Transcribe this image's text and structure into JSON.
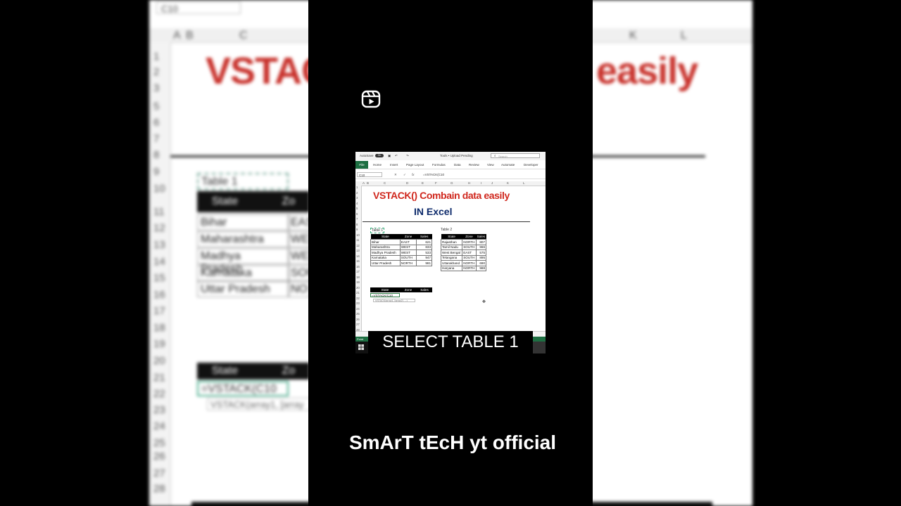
{
  "background": {
    "name_box": "C10",
    "columns": [
      "A",
      "B",
      "C",
      "K",
      "L"
    ],
    "rows": [
      "1",
      "2",
      "3",
      "5",
      "6",
      "7",
      "8",
      "9",
      "10",
      "11",
      "12",
      "13",
      "14",
      "15",
      "16",
      "17",
      "18",
      "19",
      "20",
      "21",
      "22",
      "23",
      "24",
      "25",
      "26",
      "27",
      "28"
    ],
    "title_left": "VSTACK",
    "title_right": "easily",
    "table_caption": "Table 1",
    "table_header": "State",
    "table_header_cut": "Zo",
    "states": [
      "Bihar",
      "Maharashtra",
      "Madhya Pradesh",
      "Karnataka",
      "Uttar Pradesh"
    ],
    "zones_cut": [
      "EAS",
      "WE",
      "WE",
      "SOU",
      "NO"
    ],
    "formula": "=VSTACK(C10",
    "tooltip": "VSTACK(array1, [array"
  },
  "excel": {
    "titlebar": {
      "autosave_label": "AutoSave",
      "toggle": "On",
      "file_name": "Tools • Upload Pending",
      "search_placeholder": "Search"
    },
    "ribbon_tabs": [
      "File",
      "Home",
      "Insert",
      "Page Layout",
      "Formulas",
      "Data",
      "Review",
      "View",
      "Automate",
      "Developer"
    ],
    "name_box": "C10",
    "formula": "=VSTACK(C10",
    "columns": [
      "A",
      "B",
      "C",
      "D",
      "E",
      "F",
      "G",
      "H",
      "I",
      "J",
      "K",
      "L"
    ],
    "rows": [
      "1",
      "2",
      "3",
      "4",
      "5",
      "6",
      "7",
      "8",
      "9",
      "10",
      "11",
      "12",
      "13",
      "14",
      "15",
      "16",
      "17",
      "18",
      "19",
      "20",
      "21",
      "22",
      "23",
      "24",
      "25",
      "26",
      "27",
      "28"
    ],
    "title_line1": "VSTACK() Combain data easily",
    "title_line2": "IN Excel",
    "table1": {
      "caption": "Table 1",
      "headers": [
        "State",
        "Zone",
        "Sales"
      ],
      "rows": [
        [
          "Bihar",
          "EAST",
          "621"
        ],
        [
          "Maharashtra",
          "WEST",
          "833"
        ],
        [
          "Madhya Pradesh",
          "WEST",
          "533"
        ],
        [
          "Karnataka",
          "SOUTH",
          "947"
        ],
        [
          "Uttar Pradesh",
          "NORTH",
          "981"
        ]
      ]
    },
    "table2": {
      "caption": "Table 2",
      "headers": [
        "State",
        "Zone",
        "Sales"
      ],
      "rows": [
        [
          "Rajasthan",
          "NORTH",
          "807"
        ],
        [
          "Tamil Nadu",
          "SOUTH",
          "966"
        ],
        [
          "West Bengal",
          "EAST",
          "575"
        ],
        [
          "Telangana",
          "SOUTH",
          "895"
        ],
        [
          "Uttarakhand",
          "NORTH",
          "690"
        ],
        [
          "Haryana",
          "NORTH",
          "988"
        ]
      ]
    },
    "result_headers": [
      "State",
      "Zone",
      "Sales"
    ],
    "result_formula": "=VSTACK(C10",
    "tooltip": "VSTACK(array1, [array2], ...)",
    "status": "Point"
  },
  "overlay_caption": "SELECT TABLE 1",
  "watermark": "SmArT tEcH yt official"
}
